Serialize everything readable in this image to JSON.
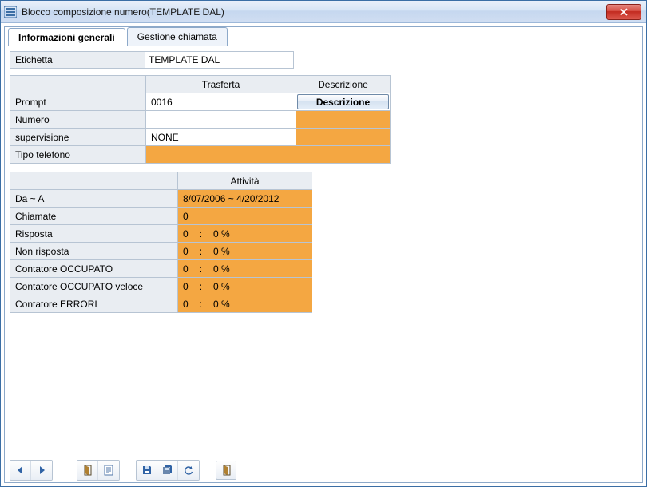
{
  "window": {
    "title": "Blocco composizione numero(TEMPLATE DAL)"
  },
  "tabs": {
    "general": "Informazioni generali",
    "call": "Gestione chiamata"
  },
  "label_row": {
    "label": "Etichetta",
    "value": "TEMPLATE DAL"
  },
  "trasferta": {
    "headers": {
      "col1": "",
      "col2": "Trasferta",
      "col3": "Descrizione"
    },
    "rows": {
      "prompt": {
        "label": "Prompt",
        "val": "0016",
        "desc_button": "Descrizione"
      },
      "numero": {
        "label": "Numero",
        "val": ""
      },
      "supervisione": {
        "label": "supervisione",
        "val": "NONE"
      },
      "tipo": {
        "label": "Tipo telefono",
        "val": ""
      }
    }
  },
  "attivita": {
    "header": "Attività",
    "rows": {
      "da_a": {
        "label": "Da ~ A",
        "val": "8/07/2006  ~  4/20/2012"
      },
      "chiamate": {
        "label": "Chiamate",
        "val": "0"
      },
      "risposta": {
        "label": "Risposta",
        "n": "0",
        "pct": "0 %"
      },
      "non_risp": {
        "label": "Non risposta",
        "n": "0",
        "pct": "0 %"
      },
      "occupato": {
        "label": "Contatore OCCUPATO",
        "n": "0",
        "pct": "0 %"
      },
      "occ_vel": {
        "label": "Contatore OCCUPATO veloce",
        "n": "0",
        "pct": "0 %"
      },
      "errori": {
        "label": "Contatore ERRORI",
        "n": "0",
        "pct": "0 %"
      }
    }
  }
}
